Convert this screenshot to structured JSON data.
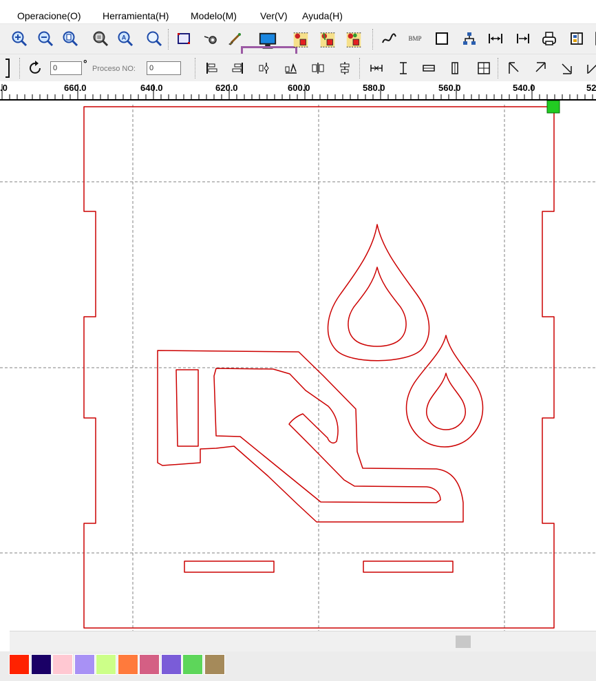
{
  "menu": [
    {
      "label": "Operacione(O)",
      "name": "menu-operacione"
    },
    {
      "label": "Herramienta(H)",
      "name": "menu-herramienta"
    },
    {
      "label": "Modelo(M)",
      "name": "menu-modelo"
    },
    {
      "label": "Ver(V)",
      "name": "menu-ver"
    },
    {
      "label": "Ayuda(H)",
      "name": "menu-ayuda"
    }
  ],
  "toolbar1": {
    "bmp_label": "BMP",
    "highlighted_tool": "monitor-icon"
  },
  "toolbar2": {
    "angle_value": "0",
    "degree_symbol": "°",
    "proceso_label": "Proceso NO:",
    "proceso_value": "0"
  },
  "ruler": {
    "labels": [
      ".0",
      "660.0",
      "640.0",
      "620.0",
      "600.0",
      "580.0",
      "560.0",
      "540.0",
      "52"
    ]
  },
  "colors": {
    "cut_path": "#cc0000",
    "guide_line": "#808080",
    "selection_handle": "#22cc22",
    "highlight_frame": "#9c5aa4"
  },
  "palette": [
    "#ff2200",
    "#1a0066",
    "#ffc8d2",
    "#a891f5",
    "#ccff88",
    "#ff7a3c",
    "#d45f84",
    "#7a5cd8",
    "#5dd65a",
    "#a58a5a"
  ]
}
